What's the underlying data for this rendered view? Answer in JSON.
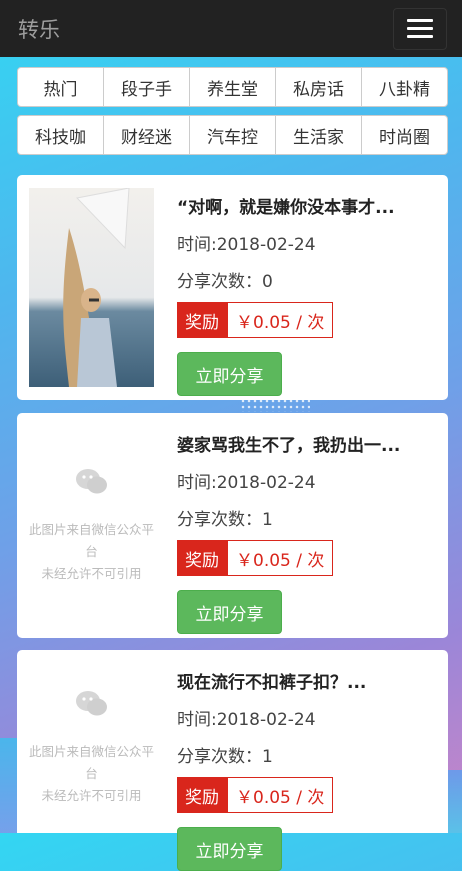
{
  "navbar": {
    "brand": "转乐"
  },
  "categories": [
    [
      "热门",
      "段子手",
      "养生堂",
      "私房话",
      "八卦精"
    ],
    [
      "科技咖",
      "财经迷",
      "汽车控",
      "生活家",
      "时尚圈"
    ]
  ],
  "placeholder_text": [
    "此图片来自微信公众平台",
    "未经允许不可引用"
  ],
  "cards": [
    {
      "title": "“对啊，就是嫌你没本事才...",
      "time": "时间:2018-02-24",
      "shares": "分享次数：0",
      "reward_label": "奖励",
      "reward_value": "￥0.05 / 次",
      "share_label": "立即分享"
    },
    {
      "title": "婆家骂我生不了，我扔出一...",
      "time": "时间:2018-02-24",
      "shares": "分享次数：1",
      "reward_label": "奖励",
      "reward_value": "￥0.05 / 次",
      "share_label": "立即分享"
    },
    {
      "title": "现在流行不扣裤子扣？...",
      "time": "时间:2018-02-24",
      "shares": "分享次数：1",
      "reward_label": "奖励",
      "reward_value": "￥0.05 / 次",
      "share_label": "立即分享"
    }
  ],
  "colors": {
    "reward_red": "#d9261c",
    "share_green": "#5cb85c",
    "navbar": "#222222"
  }
}
